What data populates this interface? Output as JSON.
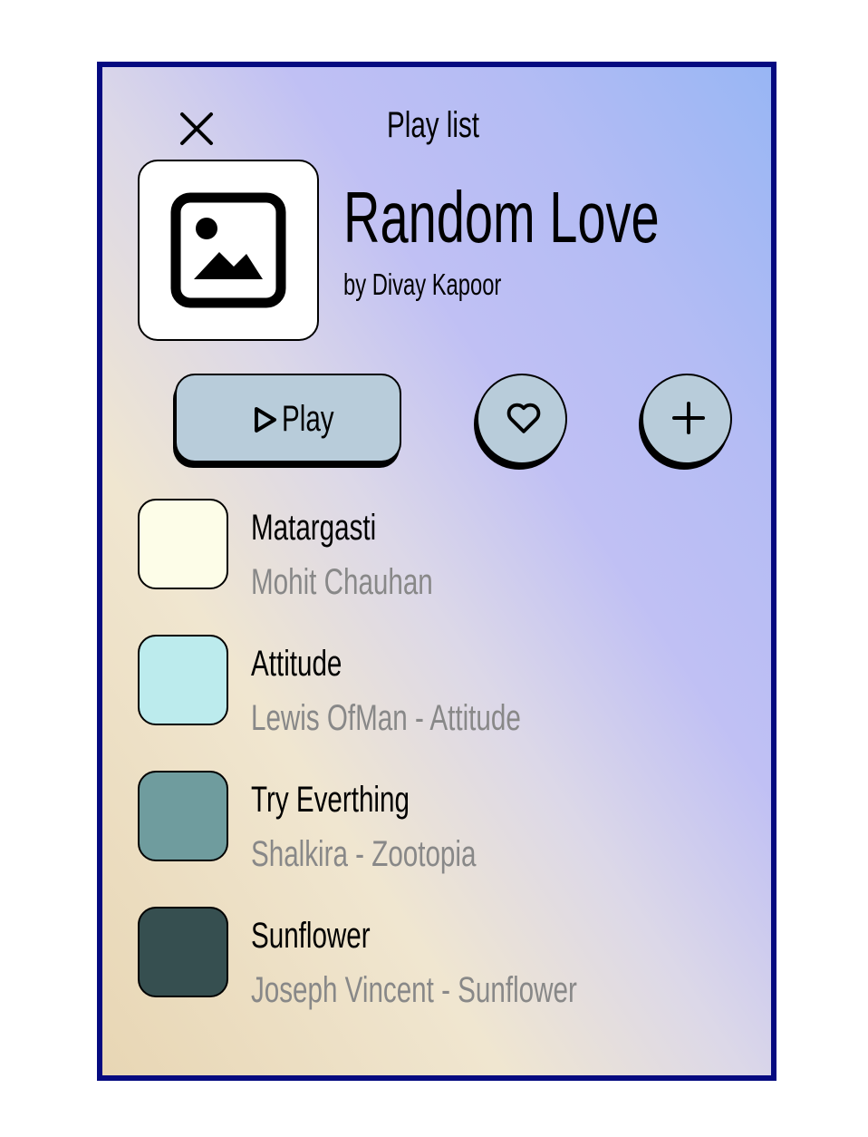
{
  "header": {
    "title": "Play list",
    "close_icon": "close-icon"
  },
  "playlist": {
    "name": "Random Love",
    "author": "by Divay Kapoor",
    "cover_icon": "image-placeholder-icon"
  },
  "actions": {
    "play_label": "Play",
    "play_icon": "play-icon",
    "like_icon": "heart-icon",
    "add_icon": "plus-icon",
    "button_color": "#b8ccda"
  },
  "songs": [
    {
      "title": "Matargasti",
      "subtitle": "Mohit Chauhan",
      "color": "#fdfde8"
    },
    {
      "title": "Attitude",
      "subtitle": "Lewis OfMan - Attitude",
      "color": "#bcebed"
    },
    {
      "title": "Try Everthing",
      "subtitle": "Shalkira - Zootopia",
      "color": "#6f9c9e"
    },
    {
      "title": "Sunflower",
      "subtitle": "Joseph Vincent - Sunflower",
      "color": "#364f50"
    }
  ],
  "theme": {
    "border_color": "#050a80",
    "subtitle_color": "#888888"
  }
}
